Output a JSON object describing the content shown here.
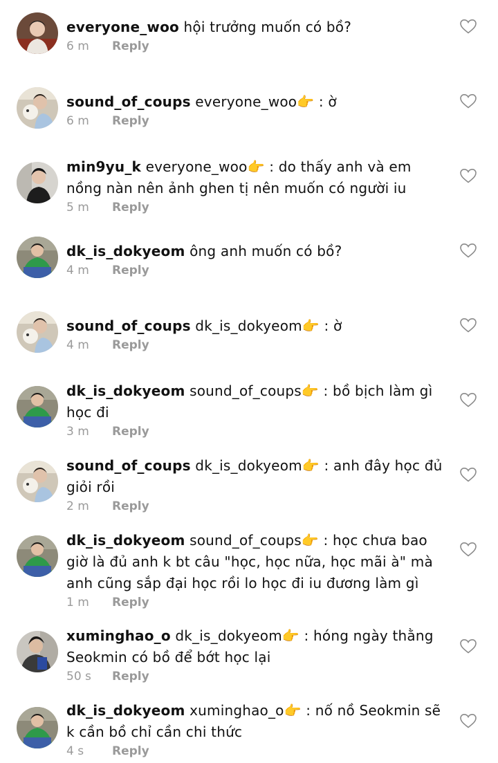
{
  "comments": [
    {
      "user": "everyone_woo",
      "text": "hội trưởng muốn có bồ?",
      "time": "6 m",
      "reply": "Reply",
      "avatar": "avatar-woo"
    },
    {
      "user": "sound_of_coups",
      "text": "everyone_woo👉 : ờ",
      "time": "6 m",
      "reply": "Reply",
      "avatar": "avatar-coups"
    },
    {
      "user": "min9yu_k",
      "text": "everyone_woo👉 : do thấy anh và em nồng nàn nên ảnh ghen tị nên muốn có người iu",
      "time": "5 m",
      "reply": "Reply",
      "avatar": "avatar-mingyu"
    },
    {
      "user": "dk_is_dokyeom",
      "text": "ông anh muốn có bồ?",
      "time": "4 m",
      "reply": "Reply",
      "avatar": "avatar-dk"
    },
    {
      "user": "sound_of_coups",
      "text": "dk_is_dokyeom👉 : ờ",
      "time": "4 m",
      "reply": "Reply",
      "avatar": "avatar-coups"
    },
    {
      "user": "dk_is_dokyeom",
      "text": "sound_of_coups👉 : bồ bịch làm gì học đi",
      "time": "3 m",
      "reply": "Reply",
      "avatar": "avatar-dk"
    },
    {
      "user": "sound_of_coups",
      "text": "dk_is_dokyeom👉 : anh đây học đủ giỏi rồi",
      "time": "2 m",
      "reply": "Reply",
      "avatar": "avatar-coups"
    },
    {
      "user": "dk_is_dokyeom",
      "text": "sound_of_coups👉 : học chưa bao giờ là đủ anh k bt câu \"học,  học nữa,  học mãi à\" mà anh cũng sắp đại học rồi lo học đi iu đương làm gì",
      "time": "1 m",
      "reply": "Reply",
      "avatar": "avatar-dk"
    },
    {
      "user": "xuminghao_o",
      "text": "dk_is_dokyeom👉 : hóng ngày thằng Seokmin có bồ để bớt học lại",
      "time": "50 s",
      "reply": "Reply",
      "avatar": "avatar-minghao"
    },
    {
      "user": "dk_is_dokyeom",
      "text": "xuminghao_o👉 : nố nồ Seokmin sẽ k cần bồ chỉ cần chi thức",
      "time": "4 s",
      "reply": "Reply",
      "avatar": "avatar-dk"
    }
  ],
  "icons": {
    "like": "heart-outline-icon"
  },
  "colors": {
    "meta": "#9a9a9a",
    "text": "#111111",
    "arrow": "#f5b400"
  }
}
